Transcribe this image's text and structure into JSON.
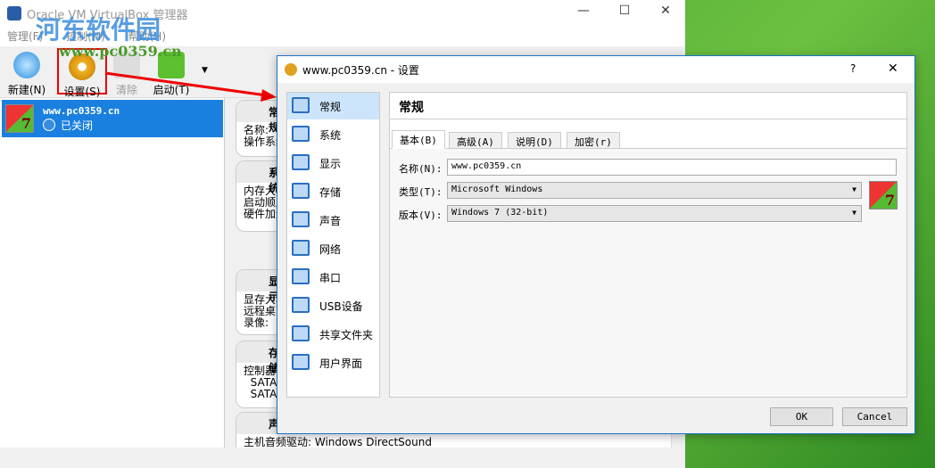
{
  "main": {
    "title": "Oracle VM VirtualBox 管理器",
    "menu": [
      "管理(F)",
      "控制(M)",
      "帮助(H)"
    ],
    "toolbar": {
      "new": "新建(N)",
      "settings": "设置(S)",
      "discard": "清除",
      "start": "启动(T)"
    },
    "vm": {
      "name": "www.pc0359.cn",
      "state": "已关闭",
      "os_badge": "7"
    },
    "details": [
      {
        "title": "常规",
        "lines": [
          "名称:",
          "操作系统:"
        ]
      },
      {
        "title": "系统",
        "lines": [
          "内存大小:",
          "启动顺序:",
          "硬件加速:"
        ]
      },
      {
        "title": "显示",
        "lines": [
          "显存大小:",
          "远程桌面:",
          "录像:"
        ]
      },
      {
        "title": "存储",
        "lines": [
          "控制器:",
          "  SATA",
          "  SATA"
        ]
      },
      {
        "title": "声音",
        "lines": [
          "主机音频驱动: Windows DirectSound"
        ]
      }
    ]
  },
  "watermark": {
    "name": "河东软件园",
    "url": "www.pc0359.cn"
  },
  "dialog": {
    "title": "www.pc0359.cn - 设置",
    "help": "?",
    "close": "✕",
    "sidebar": [
      "常规",
      "系统",
      "显示",
      "存储",
      "声音",
      "网络",
      "串口",
      "USB设备",
      "共享文件夹",
      "用户界面"
    ],
    "page_title": "常规",
    "tabs": [
      "基本(B)",
      "高级(A)",
      "说明(D)",
      "加密(r)"
    ],
    "fields": {
      "name_label": "名称(N):",
      "name_value": "www.pc0359.cn",
      "type_label": "类型(T):",
      "type_value": "Microsoft Windows",
      "version_label": "版本(V):",
      "version_value": "Windows 7 (32-bit)"
    },
    "ok": "OK",
    "cancel": "Cancel"
  },
  "colors": {
    "accent": "#1a80e0",
    "highlight": "#e00000"
  }
}
